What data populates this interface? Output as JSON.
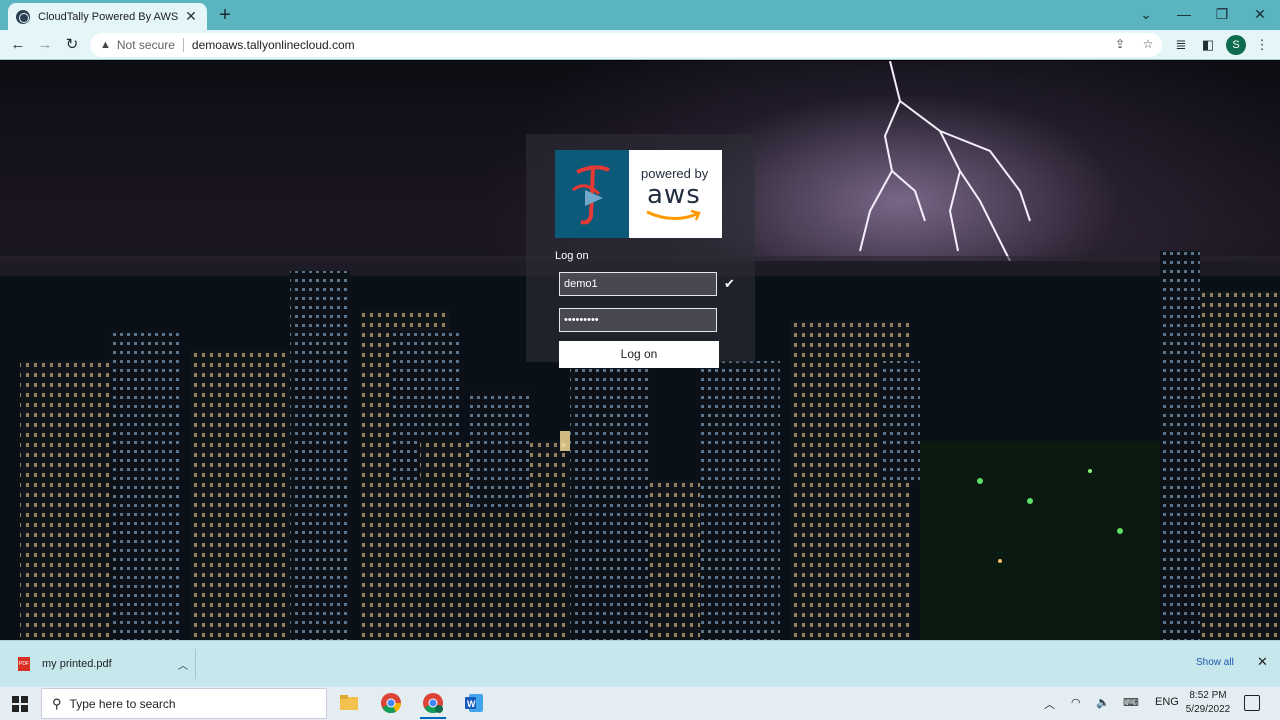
{
  "browser": {
    "tab_title": "CloudTally Powered By AWS",
    "tab_close": "✕",
    "new_tab": "+",
    "security_label": "Not secure",
    "url": "demoaws.tallyonlinecloud.com",
    "profile_initial": "S"
  },
  "login": {
    "heading": "Log on",
    "username_value": "demo1",
    "password_value": "•••••••••",
    "submit_label": "Log on",
    "logo_powered_by": "powered by",
    "logo_aws": "aws"
  },
  "downloads": {
    "file_name": "my printed.pdf",
    "show_all": "Show all"
  },
  "taskbar": {
    "search_placeholder": "Type here to search",
    "language": "ENG",
    "time": "8:52 PM",
    "date": "5/29/2022"
  },
  "colors": {
    "tabstrip": "#5bb5c0",
    "toolbar": "#e4f6f8",
    "download_bar": "#c6e8ec",
    "tally_blue": "#0b5a7a",
    "aws_orange": "#ff9900"
  }
}
